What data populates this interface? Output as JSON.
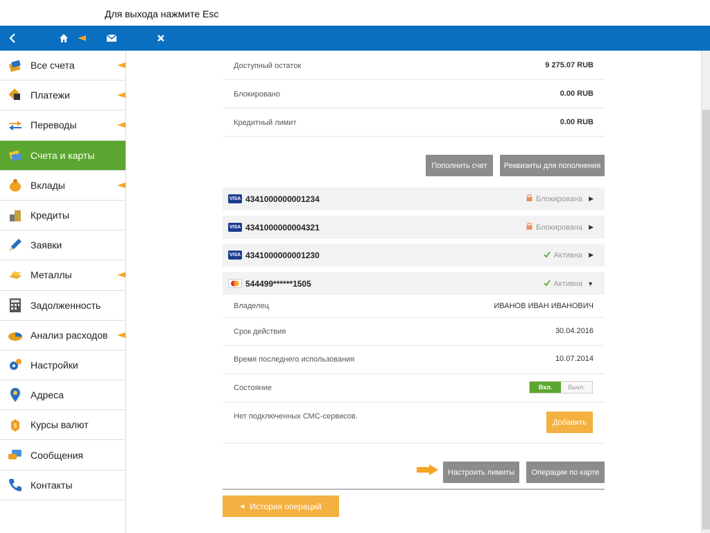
{
  "hint": "Для выхода нажмите Esc",
  "colors": {
    "topbar": "#0a6fc0",
    "active": "#5ba630",
    "accent": "#f5a623",
    "button_grey": "#8c8c8c",
    "button_orange": "#f4b040"
  },
  "topbar": {
    "icons": [
      "chevron-left-icon",
      "home-icon",
      "mail-icon",
      "close-icon"
    ]
  },
  "sidebar": {
    "items": [
      {
        "label": "Все счета",
        "icon": "accounts-icon",
        "active": false,
        "arrow": true
      },
      {
        "label": "Платежи",
        "icon": "payments-icon",
        "active": false,
        "arrow": true
      },
      {
        "label": "Переводы",
        "icon": "transfers-icon",
        "active": false,
        "arrow": true
      },
      {
        "label": "Счета и карты",
        "icon": "cards-icon",
        "active": true,
        "arrow": false
      },
      {
        "label": "Вклады",
        "icon": "piggy-bank-icon",
        "active": false,
        "arrow": true
      },
      {
        "label": "Кредиты",
        "icon": "credits-icon",
        "active": false,
        "arrow": false
      },
      {
        "label": "Заявки",
        "icon": "pencil-icon",
        "active": false,
        "arrow": false
      },
      {
        "label": "Металлы",
        "icon": "gold-bars-icon",
        "active": false,
        "arrow": true
      },
      {
        "label": "Задолженность",
        "icon": "calculator-icon",
        "active": false,
        "arrow": false
      },
      {
        "label": "Анализ расходов",
        "icon": "pie-chart-icon",
        "active": false,
        "arrow": true
      },
      {
        "label": "Настройки",
        "icon": "gear-icon",
        "active": false,
        "arrow": false
      },
      {
        "label": "Адреса",
        "icon": "map-pin-icon",
        "active": false,
        "arrow": false
      },
      {
        "label": "Курсы валют",
        "icon": "currency-icon",
        "active": false,
        "arrow": false
      },
      {
        "label": "Сообщения",
        "icon": "chat-icon",
        "active": false,
        "arrow": false
      },
      {
        "label": "Контакты",
        "icon": "phone-icon",
        "active": false,
        "arrow": false
      }
    ]
  },
  "account": {
    "available_label": "Доступный остаток",
    "available_value": "9 275.07 RUB",
    "blocked_label": "Блокировано",
    "blocked_value": "0.00 RUB",
    "credit_limit_label": "Кредитный лимит",
    "credit_limit_value": "0.00 RUB",
    "topup_button": "Пополнить счет",
    "details_button": "Реквизиты для пополнения"
  },
  "cards": [
    {
      "system": "VISA",
      "number": "4341000000001234",
      "status": "Блокирована",
      "state": "blocked",
      "arrow": "▶"
    },
    {
      "system": "VISA",
      "number": "4341000000004321",
      "status": "Блокирована",
      "state": "blocked",
      "arrow": "▶"
    },
    {
      "system": "VISA",
      "number": "4341000000001230",
      "status": "Активна",
      "state": "active",
      "arrow": "▶"
    },
    {
      "system": "MasterCard",
      "number": "544499******1505",
      "status": "Активна",
      "state": "active",
      "arrow": "▼"
    }
  ],
  "card_details": {
    "owner_label": "Владелец",
    "owner_value": "ИВАНОВ ИВАН ИВАНОВИЧ",
    "expiry_label": "Срок действия",
    "expiry_value": "30.04.2016",
    "last_use_label": "Время последнего использования",
    "last_use_value": "10.07.2014",
    "state_label": "Состояние",
    "toggle_on": "Вкл.",
    "toggle_off": "Выкл.",
    "sms_label": "Нет подключенных СМС-сервисов.",
    "add_button": "Добавить",
    "limits_button": "Настроить лимиты",
    "operations_button": "Операции по карте"
  },
  "history_button": "История операций"
}
